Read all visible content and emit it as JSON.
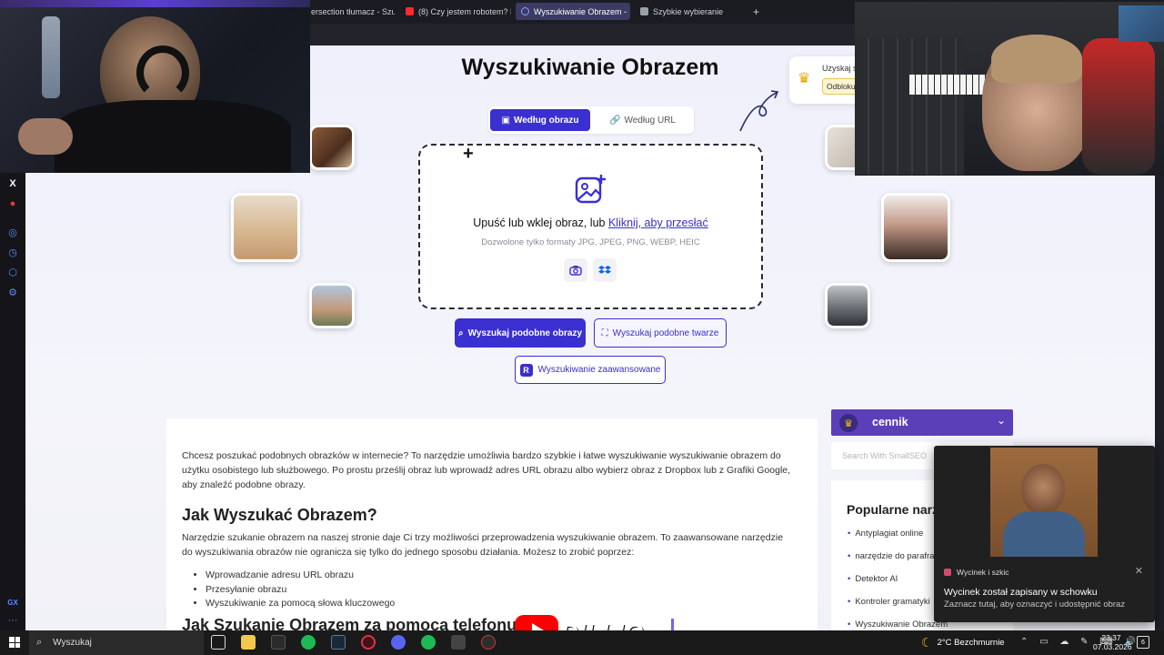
{
  "browser": {
    "tabs": [
      {
        "label": "ersection tłumacz - Szu",
        "icon_color": "#3a3a48"
      },
      {
        "label": "(8) Czy jestem robotem? N",
        "icon_color": "#ff2a2a"
      },
      {
        "label": "Wyszukiwanie Obrazem -",
        "icon_color": "#6e7cff"
      },
      {
        "label": "Szybkie wybieranie",
        "icon_color": "#9aa0aa"
      }
    ],
    "new_tab_glyph": "+"
  },
  "page": {
    "title": "Wyszukiwanie Obrazem",
    "mode_tabs": [
      {
        "label": "Według obrazu",
        "icon": "image-icon"
      },
      {
        "label": "Według URL",
        "icon": "link-icon"
      }
    ],
    "dropzone": {
      "text_prefix": "Upuść lub wklej obraz, lub",
      "link": "Kliknij, aby przesłać",
      "formats": "Dozwolone tylko formaty JPG, JPEG, PNG, WEBP, HEIC",
      "icons": [
        "camera-icon",
        "dropbox-icon"
      ]
    },
    "buttons": {
      "similar_images": "Wyszukaj podobne obrazy",
      "similar_faces": "Wyszukaj podobne twarze",
      "advanced": "Wyszukiwanie zaawansowane"
    },
    "upsell": {
      "title": "Uzyskaj s",
      "button": "Odblokuj"
    },
    "thumbnails": [
      "food",
      "woman-blonde",
      "palace",
      "cat",
      "woman-portrait",
      "car"
    ],
    "article": {
      "intro": "Chcesz poszukać podobnych obrazków w internecie? To narzędzie umożliwia bardzo szybkie i łatwe wyszukiwanie wyszukiwanie obrazem do użytku osobistego lub służbowego. Po prostu prześlij obraz lub wprowadź adres URL obrazu albo wybierz obraz z Dropbox lub z Grafiki Google, aby znaleźć podobne obrazy.",
      "heading1": "Jak Wyszukać Obrazem?",
      "para2": "Narzędzie szukanie obrazem na naszej stronie daje Ci trzy możliwości przeprowadzenia wyszukiwanie obrazem. To zaawansowane narzędzie do wyszukiwania obrazów nie ogranicza się tylko do jednego sposobu działania. Możesz to zrobić poprzez:",
      "list": [
        "Wprowadzanie adresu URL obrazu",
        "Przesyłanie obrazu",
        "Wyszukiwanie za pomocą słowa kluczowego"
      ],
      "heading2": "Jak Szukanie Obrazem za pomocą telefonu i"
    },
    "sidebar": {
      "pricing_label": "cennik",
      "search_placeholder": "Search With SmallSEO",
      "popular_title": "Popularne narz",
      "popular_items": [
        "Antyplagiat online",
        "narzędzie do parafraz",
        "Detektor AI",
        "Kontroler gramatyki",
        "Wyszukiwanie Obrazem"
      ]
    }
  },
  "notification": {
    "app": "Wycinek i szkic",
    "title": "Wycinek został zapisany w schowku",
    "subtitle": "Zaznacz tutaj, aby oznaczyć i udostępnić obraz"
  },
  "overlay": {
    "brand_word": "DILLIQ"
  },
  "left_sidebar": {
    "labels": [
      "X",
      "GX"
    ]
  },
  "taskbar": {
    "search_label": "Wyszukaj",
    "weather": "2°C  Bezchmurnie",
    "time": "23:37",
    "date": "07.03.2026",
    "notifications_count": "6"
  }
}
